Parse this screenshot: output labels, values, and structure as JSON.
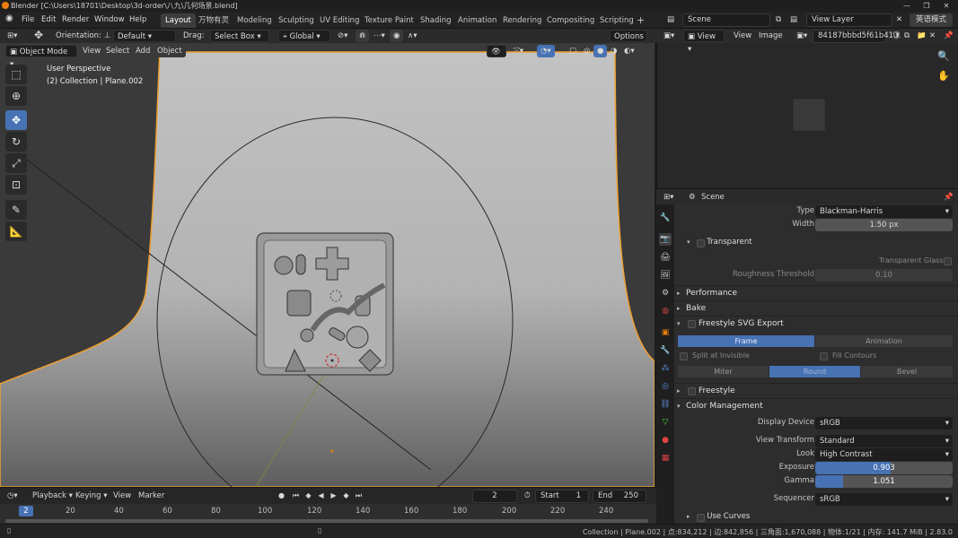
{
  "title": "Blender [C:\\Users\\18701\\Desktop\\3d-order\\八九\\几何场景.blend]",
  "menu": [
    "File",
    "Edit",
    "Render",
    "Window",
    "Help"
  ],
  "workspace_tabs": [
    "Layout",
    "万物有灵",
    "Modeling",
    "Sculpting",
    "UV Editing",
    "Texture Paint",
    "Shading",
    "Animation",
    "Rendering",
    "Compositing",
    "Scripting"
  ],
  "active_tab": "Layout",
  "scene_name": "Scene",
  "view_layer": "View Layer",
  "lang_button": "英语模式",
  "tool_header": {
    "orientation_label": "Orientation:",
    "orientation_value": "Default",
    "drag_label": "Drag:",
    "drag_value": "Select Box",
    "transform_value": "Global",
    "options": "Options"
  },
  "viewport_header": {
    "mode": "Object Mode",
    "items": [
      "View",
      "Select",
      "Add",
      "Object"
    ]
  },
  "viewport_text": {
    "perspective": "User Perspective",
    "collection": "(2) Collection | Plane.002"
  },
  "image_editor": {
    "view": "View",
    "view2": "View",
    "image": "Image",
    "image_name": "84187bbbd5f61b41..."
  },
  "properties": {
    "scene": "Scene",
    "filter_type_label": "Type",
    "filter_type_value": "Blackman-Harris",
    "width_label": "Width",
    "width_value": "1.50 px",
    "transparent": "Transparent",
    "transparent_glass": "Transparent Glass",
    "roughness_label": "Roughness Threshold",
    "roughness_value": "0.10",
    "performance": "Performance",
    "bake": "Bake",
    "svg_export": "Freestyle SVG Export",
    "svg_frame": "Frame",
    "svg_animation": "Animation",
    "split_invisible": "Split at Invisible",
    "fill_contours": "Fill Contours",
    "miter": "Miter",
    "round": "Round",
    "bevel": "Bevel",
    "freestyle": "Freestyle",
    "color_management": "Color Management",
    "display_device_label": "Display Device",
    "display_device_value": "sRGB",
    "view_transform_label": "View Transform",
    "view_transform_value": "Standard",
    "look_label": "Look",
    "look_value": "High Contrast",
    "exposure_label": "Exposure",
    "exposure_value": "0.903",
    "exposure_fill": 0.55,
    "gamma_label": "Gamma",
    "gamma_value": "1.051",
    "gamma_fill": 0.2,
    "sequencer_label": "Sequencer",
    "sequencer_value": "sRGB",
    "use_curves": "Use Curves"
  },
  "timeline": {
    "playback": "Playback",
    "keying": "Keying",
    "view": "View",
    "marker": "Marker",
    "current_frame": "2",
    "start_label": "Start",
    "start_value": "1",
    "end_label": "End",
    "end_value": "250",
    "ticks": [
      "20",
      "40",
      "60",
      "80",
      "100",
      "120",
      "140",
      "160",
      "180",
      "200",
      "220",
      "240"
    ],
    "frame_badge": "2"
  },
  "status": "Collection | Plane.002 | 点:834,212 | 边:842,856 | 三角面:1,670,088 | 物体:1/21 | 内存: 141.7 MiB | 2.83.0",
  "colors": {
    "accent": "#4772b3",
    "selection_outline": "#f0a030",
    "blender_orange": "#e87d0d"
  }
}
